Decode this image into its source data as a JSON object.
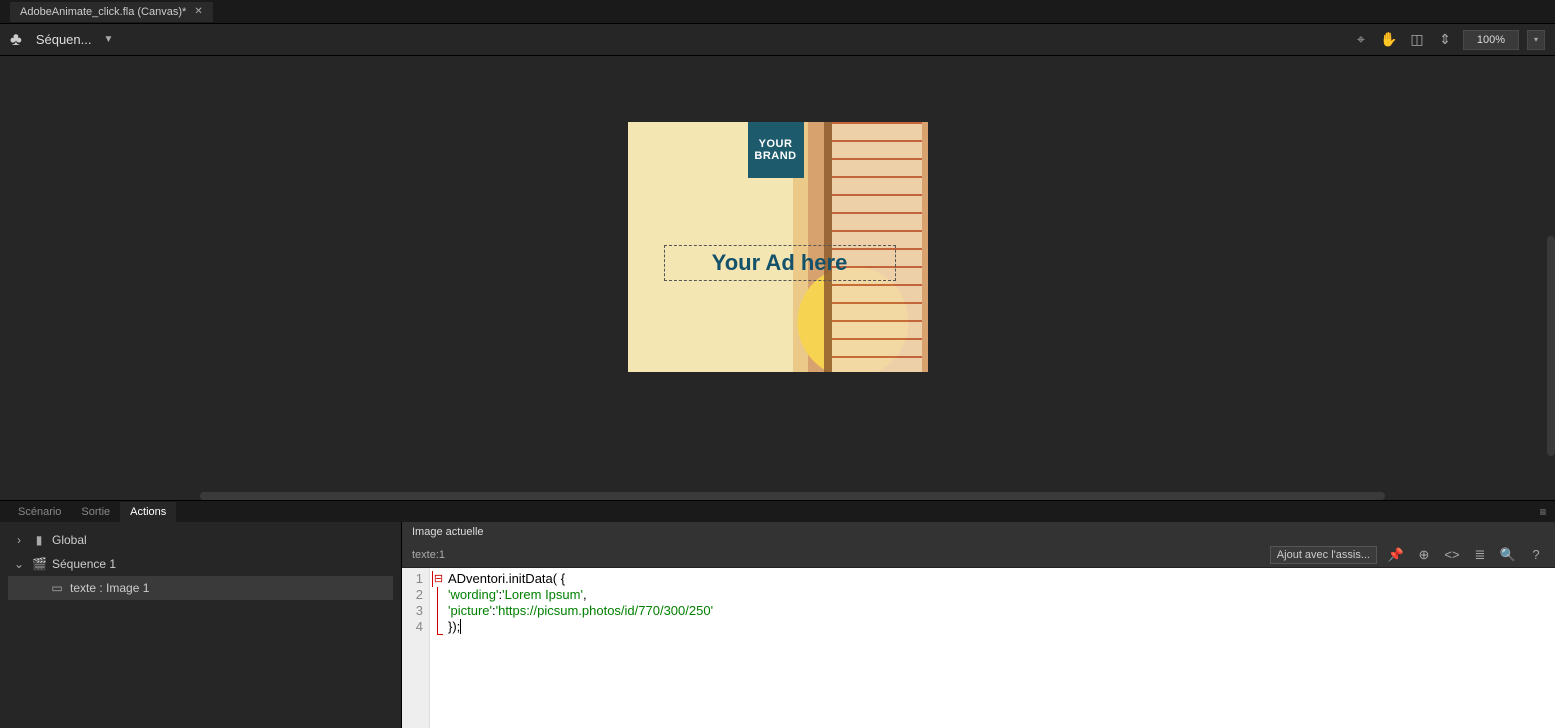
{
  "tab": {
    "title": "AdobeAnimate_click.fla (Canvas)*"
  },
  "toolbar": {
    "scene_label": "Séquen...",
    "zoom": "100%"
  },
  "canvas": {
    "brand_line1": "YOUR",
    "brand_line2": "BRAND",
    "ad_text": "Your Ad here"
  },
  "panel_tabs": [
    "Scénario",
    "Sortie",
    "Actions"
  ],
  "active_panel_tab": 2,
  "tree": {
    "global": "Global",
    "scene": "Séquence 1",
    "item": "texte : Image 1"
  },
  "code_panel": {
    "header": "Image actuelle",
    "location": "texte:1",
    "assist_btn": "Ajout avec l'assis...",
    "lines": [
      {
        "n": "1",
        "text_a": "ADventori.initData( {",
        "text_b": ""
      },
      {
        "n": "2",
        "text_a": "    ",
        "key": "'wording'",
        "colon": ":",
        "val": "'Lorem Ipsum'",
        "tail": ","
      },
      {
        "n": "3",
        "text_a": "    ",
        "key": "'picture'",
        "colon": ":",
        "val": "'https://picsum.photos/id/770/300/250'",
        "tail": ""
      },
      {
        "n": "4",
        "text_a": "});",
        "text_b": ""
      }
    ]
  }
}
